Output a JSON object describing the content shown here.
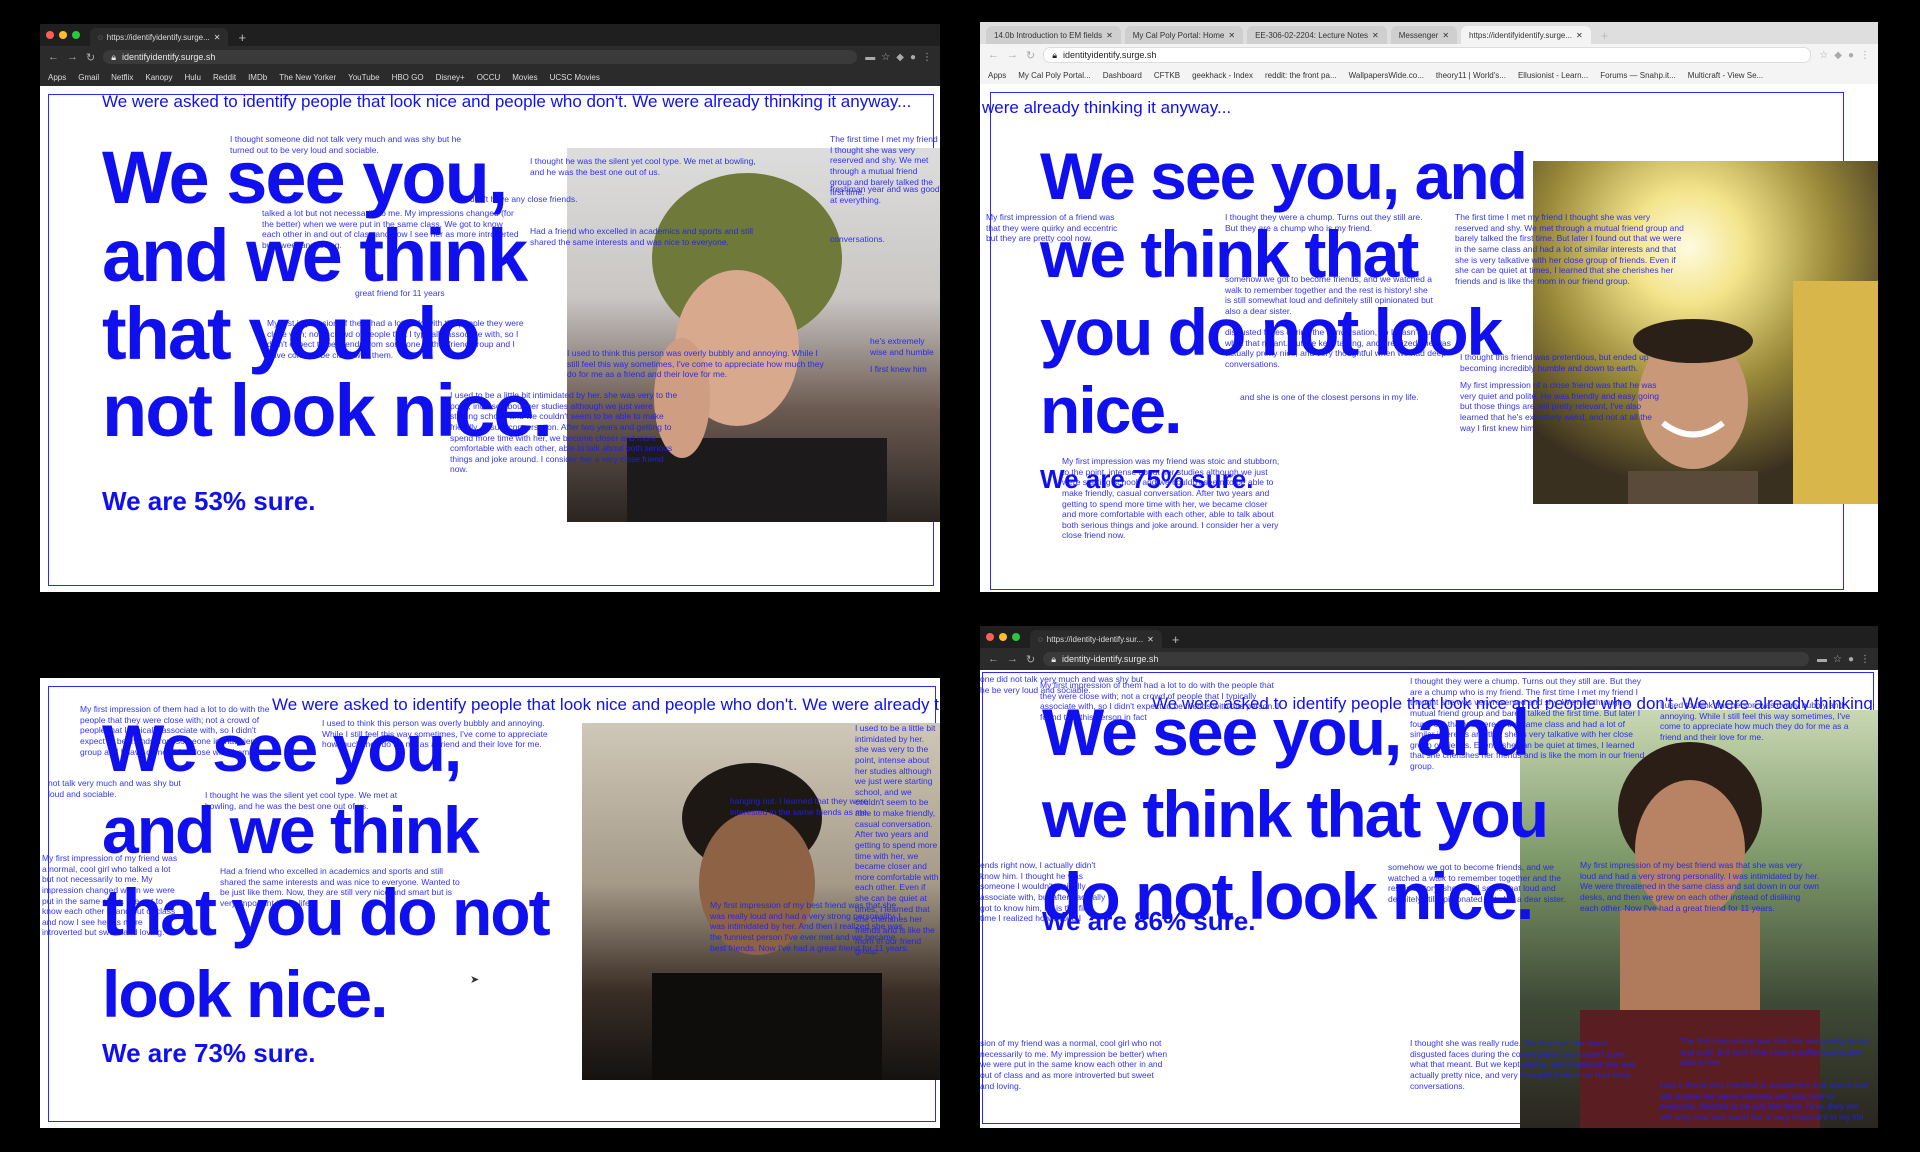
{
  "colors": {
    "text_blue": "#1010ee",
    "frame_blue": "#2a2aff",
    "background": "#000000"
  },
  "ticker_text": "We were asked to identify people that look nice and people who don't. We were already thinking it anyway...",
  "ticker_fragment": "were already thinking it anyway...",
  "headline": "We see you, and we think that you do not look nice.",
  "window1": {
    "tab_title": "https://identifyidentify.surge...",
    "url": "identifyidentify.surge.sh",
    "bookmarks": [
      "Apps",
      "Gmail",
      "Netflix",
      "Kanopy",
      "Hulu",
      "Reddit",
      "IMDb",
      "The New Yorker",
      "YouTube",
      "HBO GO",
      "Disney+",
      "OCCU",
      "Movies",
      "UCSC Movies"
    ],
    "headline_lines": [
      "We see you,",
      "and we think",
      "that you do",
      "not look nice."
    ],
    "sure": "We are 53% sure.",
    "paragraphs": [
      "I thought someone did not talk very much and was shy but he turned out to be very loud and sociable.",
      "I thought he was the silent yet cool type. We met at bowling, and he was the best one out of us.",
      "don't have any close friends.",
      "talked a lot but not necessarily to me. My impressions changed (for the better) when we were put in the same class. We got to know each other in and out of class and now I see her as more introverted but sweet and loving.",
      "Had a friend who excelled in academics and sports and still shared the same interests and was nice to everyone.",
      "great friend for 11 years",
      "My first impression of them had a lot to do with the people they were close with; not a crowd of people that I typically associate with, so I didn't expect to be friends from someone in that friend group and I have come to be close with them.",
      "I used to think this person was overly bubbly and annoying. While I still feel this way sometimes, I've come to appreciate how much they do for me as a friend and their love for me.",
      "I used to be a little bit intimidated by her. she was very to the point, intense about her studies although we just were starting school, and we couldn't seem to be able to make friendly, casual conversation. After two years and getting to spend more time with her, we became closer and more comfortable with each other, able to talk about both serious things and joke around. I consider her a very close friend now.",
      "The first time I met my friend I thought she was very reserved and shy. We met through a mutual friend group and barely talked the first time.",
      "freshman year and was good at everything.",
      "conversations.",
      "he's extremely wise and humble",
      "I first knew him"
    ]
  },
  "window2": {
    "tabs": [
      "14.0b Introduction to EM fields",
      "My Cal Poly Portal: Home",
      "EE-306-02-2204: Lecture Notes",
      "Messenger",
      "https://identifyidentify.surge..."
    ],
    "url": "identityidentify.surge.sh",
    "bookmarks": [
      "Apps",
      "My Cal Poly Portal...",
      "Dashboard",
      "CFTKB",
      "geekhack - Index",
      "reddit: the front pa...",
      "WallpapersWide.co...",
      "theory11 | World's...",
      "Ellusionist - Learn...",
      "Forums — Snahp.it...",
      "Multicraft - View Se..."
    ],
    "headline_lines": [
      "We see you, and",
      "we think that",
      "you do not look",
      "nice."
    ],
    "sure": "We are 75% sure.",
    "paragraphs": [
      "I thought they were a chump. Turns out they still are. But they are a chump who is my friend.",
      "The first time I met my friend I thought she was very reserved and shy. We met through a mutual friend group and barely talked the first time. But later I found out that we were in the same class and had a lot of similar interests and that she is very talkative with her close group of friends. Even if she can be quiet at times, I learned that she cherishes her friends and is like the mom in our friend group.",
      "somehow we got to become friends, and we watched a walk to remember together and the rest is history! she is still somewhat loud and definitely still opinionated but also a dear sister.",
      "disgusted faces during the conversation, so I wasn't sure what that meant. But we kept talking, and I realized she was actually pretty nice, and very thoughtful when we had deep conversations.",
      "and she is one of the closest persons in my life.",
      "I thought this friend was pretentious, but ended up becoming incredibly humble and down to earth.",
      "My first impression of a close friend was that he was very quiet and polite. He was friendly and easy going but those things are still pretty relevant, I've also learned that he's extremely weird, and not at all the way I first knew him",
      "My first impression was my friend was stoic and stubborn, to the point, intense about her studies although we just were starting school, and we couldn't seem to be able to make friendly, casual conversation. After two years and getting to spend more time with her, we became closer and more comfortable with each other, able to talk about both serious things and joke around. I consider her a very close friend now.",
      "My first impression of a friend was that they were quirky and eccentric but they are pretty cool now."
    ]
  },
  "window3": {
    "headline_lines": [
      "We see you,",
      "and we think",
      "that you do not",
      "look nice."
    ],
    "sure": "We are 73% sure.",
    "paragraphs": [
      "My first impression of them had a lot to do with the people that they were close with; not a crowd of people that I typically associate with, so I didn't expect to be friends from someone in that friend group and I have come to be close with them.",
      "I used to think this person was overly bubbly and annoying. While I still feel this way sometimes, I've come to appreciate how much they do for me as a friend and their love for me.",
      "I used to be a little bit intimidated by her. she was very to the point, intense about her studies although we just were starting school, and we couldn't seem to be able to make friendly, casual conversation. After two years and getting to spend more time with her, we became closer and more comfortable with each other. Even if she can be quiet at times, I learned that she cherishes her friends and is like the mom in our friend group.",
      "not talk very much and was shy but loud and sociable.",
      "I thought he was the silent yet cool type. We met at bowling, and he was the best one out of us.",
      "My first impression of my friend was a normal, cool girl who talked a lot but not necessarily to me. My impression changed when we were put in the same class. We got to know each other in and out of class and now I see her as more introverted but sweet and loving.",
      "Had a friend who excelled in academics and sports and still shared the same interests and was nice to everyone. Wanted to be just like them. Now, they are still very nice and smart but is very important in my life.",
      "hanging out. I learned that they were interested in the same friends as me.",
      "My first impression of my best friend was that she was really loud and had a very strong personality. I was intimidated by her. And then I realized she was the funniest person I've ever met and we became best friends. Now I've had a great friend for 11 years."
    ]
  },
  "window4": {
    "tab_title": "https://identity-identify.sur...",
    "url": "identity-identify.surge.sh",
    "headline_lines": [
      "We see you, and",
      "we think that you",
      "do not look nice."
    ],
    "sure": "We are 86% sure.",
    "paragraphs": [
      "one did not talk very much and was shy but he be very loud and sociable.",
      "My first impression of them had a lot to do with the people that they were close with; not a crowd of people that I typically associate with, so I didn't expect to be friends with this person. I found that this person in fact",
      "I thought they were a chump. Turns out they still are. But they are a chump who is my friend. The first time I met my friend I thought she was very reserved and shy. We met through a mutual friend group and barely talked the first time. But later I found out that we were in the same class and had a lot of similar interests and that she is very talkative with her close group of friends. Even if she can be quiet at times, I learned that she cherishes her friends and is like the mom in our friend group.",
      "I used to think this person was overly bubbly and annoying. While I still feel this way sometimes, I've come to appreciate how much they do for me as a friend and their love for me.",
      "ends right now, I actually didn't know him. I thought he was someone I wouldn't typically associate with, but after I actually got to know him, he is the first time I realized how wrong I",
      "somehow we got to become friends, and we watched a walk to remember together and the rest is history! she is still somewhat loud and definitely still opinionated but also a dear sister.",
      "My first impression of my best friend was that she was very loud and had a very strong personality. I was intimidated by her. We were threatened in the same class and sat down in our own desks, and then we grew on each other instead of disliking each other. Now I've had a great friend for 11 years.",
      "sion of my friend was a normal, cool girl who not necessarily to me. My impression be better) when we were put in the same know each other in and out of class and as more introverted but sweet and loving.",
      "I thought she was really rude. We first met she made disgusted faces during the conversation, so I wasn't sure what that meant. But we kept talking, and I realized she was actually pretty nice, and very thoughtful when we had deep conversations.",
      "The first impression was that she was pretty mean and cold. But over time I saw a softer and kinder side to her.",
      "Had a friend who excelled in academics and sports and still shared the same interests and was nice to everyone. Wanted to be just like them. Now, they are still very nice and smart but is very important in my life."
    ]
  }
}
